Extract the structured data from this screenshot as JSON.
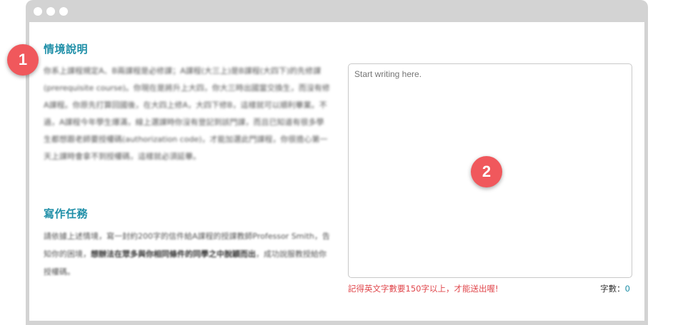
{
  "scenario": {
    "title": "情境說明",
    "body": "你系上課程規定A、B兩課程是必修課；A課程(大三上)是B課程(大四下)的先修課(prerequisite course)。你現在是將升上大四，你大三時出國當交換生，而沒有修A課程。你原先打算回國後，在大四上修A，大四下修B，這樣就可以順利畢業。不過，A課程今年學生爆滿，線上選課時你沒有登記到該門課，而且已知道有很多學生都想跟老師要授權碼(authorization code)，才能加選此門課程，你很擔心第一天上課時會拿不到授權碼，這樣就必須延畢。"
  },
  "task": {
    "title": "寫作任務",
    "body_part1": "請依據上述情境，寫一封約200字的信件給A課程的授課教師Professor Smith，告知你的困境，",
    "body_bold": "想辦法在眾多與你相同條件的同學之中脫穎而出",
    "body_part2": "，成功說服教授給你授權碼。"
  },
  "editor": {
    "placeholder": "Start writing here."
  },
  "footer": {
    "hint": "記得英文字數要150字以上，才能送出喔!",
    "count_label": "字數：",
    "count_value": "0"
  },
  "markers": {
    "one": "1",
    "two": "2"
  }
}
